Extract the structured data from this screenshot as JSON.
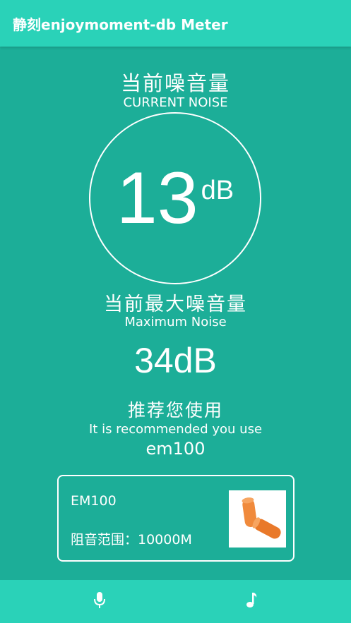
{
  "app_bar": {
    "title": "静刻enjoymoment-db Meter"
  },
  "current": {
    "title_cn": "当前噪音量",
    "title_en": "CURRENT NOISE",
    "value": "13",
    "unit": "dB"
  },
  "maximum": {
    "title_cn": "当前最大噪音量",
    "title_en": "Maximum Noise",
    "value": "34dB"
  },
  "recommendation": {
    "title_cn": "推荐您使用",
    "title_en": "It is recommended you use",
    "model": "em100"
  },
  "product": {
    "name": "EM100",
    "range": "阻音范围：10000M",
    "image": "orange-earplugs"
  },
  "bottom_nav": {
    "items": [
      {
        "icon": "microphone-icon"
      },
      {
        "icon": "music-note-icon"
      }
    ]
  },
  "colors": {
    "background": "#1cae98",
    "bar": "#2ad2b8",
    "text": "#ffffff",
    "earplug": "#f08a3c"
  }
}
